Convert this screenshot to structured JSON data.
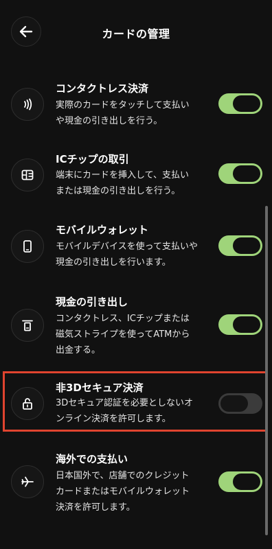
{
  "header": {
    "title": "カードの管理",
    "back_icon": "arrow-left-icon"
  },
  "colors": {
    "toggle_on": "#9fd47a",
    "toggle_off": "#3b3b3b",
    "highlight": "#e0442f",
    "background": "#111111"
  },
  "settings": [
    {
      "title": "コンタクトレス決済",
      "description": "実際のカードをタッチして支払い\nや現金の引き出しを行う。",
      "icon": "contactless-icon",
      "enabled": true
    },
    {
      "title": "ICチップの取引",
      "description": "端末にカードを挿入して、支払い\nまたは現金の引き出しを行う。",
      "icon": "chip-icon",
      "enabled": true
    },
    {
      "title": "モバイルウォレット",
      "description": "モバイルデバイスを使って支払いや\n現金の引き出しを行います。",
      "icon": "phone-icon",
      "enabled": true
    },
    {
      "title": "現金の引き出し",
      "description": "コンタクトレス、ICチップまたは\n磁気ストライプを使ってATMから\n出金する。",
      "icon": "atm-icon",
      "enabled": true
    },
    {
      "title": "非3Dセキュア決済",
      "description": "3Dセキュア認証を必要としないオ\nンライン決済を許可します。",
      "icon": "unlock-icon",
      "enabled": false
    },
    {
      "title": "海外での支払い",
      "description": "日本国外で、店舗でのクレジット\nカードまたはモバイルウォレット\n決済を許可します。",
      "icon": "airplane-icon",
      "enabled": true
    }
  ]
}
